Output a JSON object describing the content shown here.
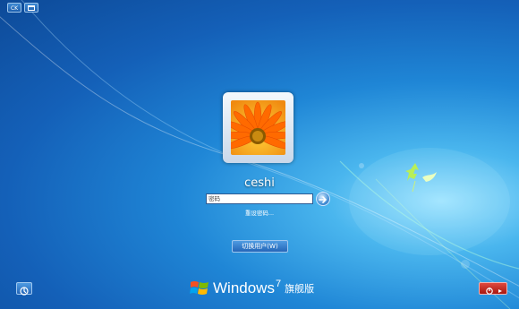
{
  "top_controls": {
    "left_icon": "keyboard-layout-icon",
    "left_label": "CK",
    "right_icon": "window-icon"
  },
  "user": {
    "name": "ceshi",
    "avatar": "orange-flower"
  },
  "login": {
    "password_placeholder": "密码",
    "reset_link": "重设密码...",
    "submit_icon": "arrow-right-icon"
  },
  "switch_user_label": "切换用户(W)",
  "bottom": {
    "ease_of_access_icon": "ease-of-access-icon",
    "power_icon": "power-icon",
    "power_menu_icon": "triangle-right-icon"
  },
  "branding": {
    "logo": "windows-flag-logo",
    "word": "Windows",
    "version": "7",
    "edition": "旗舰版"
  },
  "colors": {
    "background": "#1f86d6",
    "power": "#c62a20"
  }
}
